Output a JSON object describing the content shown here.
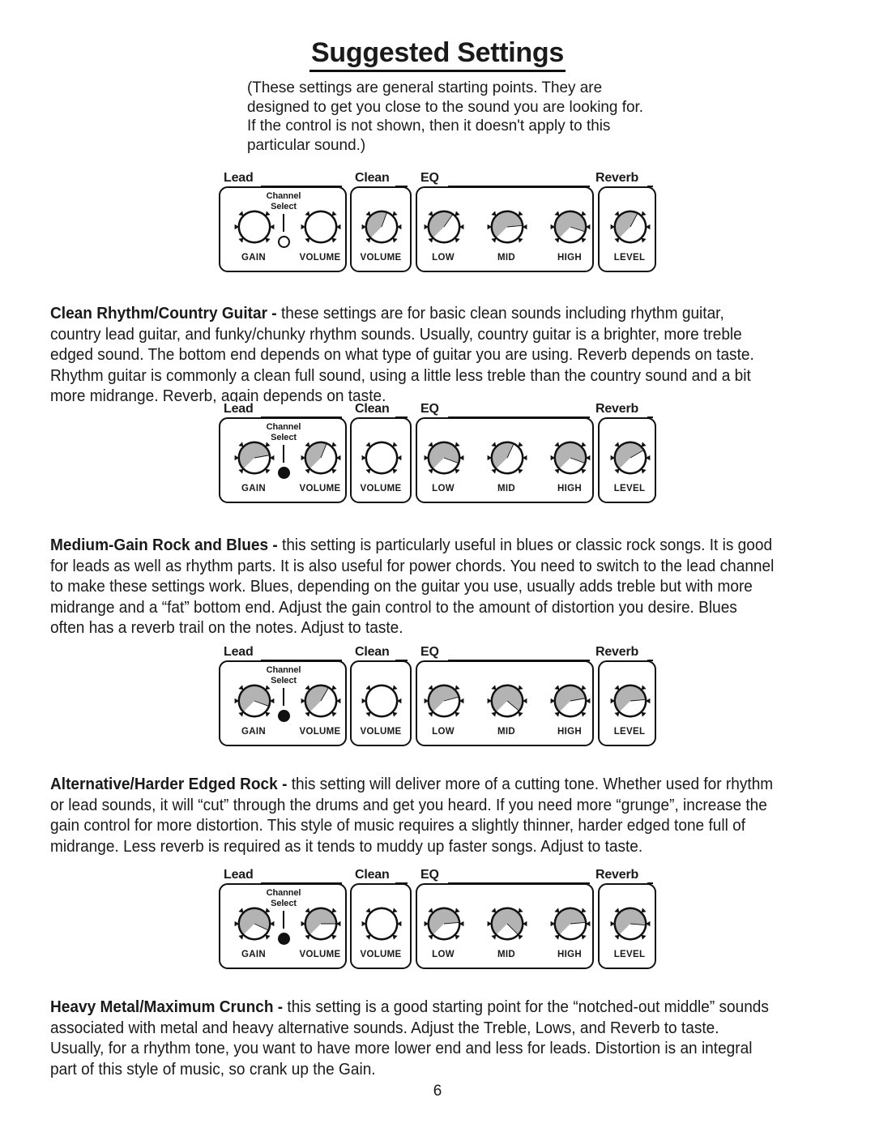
{
  "document": {
    "title": "Suggested Settings",
    "intro": "(These settings are general starting points.  They are designed to get you close to the sound you are looking for.  If the control is not shown, then it doesn't apply to this particular sound.)",
    "page_number": "6"
  },
  "panel_labels": {
    "lead": "Lead",
    "clean": "Clean",
    "eq": "EQ",
    "reverb": "Reverb",
    "channel_select": "Channel Select",
    "channel_select_line1": "Channel",
    "channel_select_line2": "Select",
    "gain": "GAIN",
    "lead_volume": "VOLUME",
    "clean_volume": "VOLUME",
    "low": "LOW",
    "mid": "MID",
    "high": "HIGH",
    "level": "LEVEL"
  },
  "colors": {
    "ink": "#111111",
    "wedge_fill": "#b3b3b3",
    "paper": "#ffffff"
  },
  "sections": [
    {
      "id": "clean-rhythm-country-guitar",
      "heading": "Clean Rhythm/Country Guitar",
      "dash": " - ",
      "body": "these settings are for basic clean sounds including rhythm guitar, country lead guitar, and funky/chunky rhythm sounds.  Usually, country guitar is a brighter, more treble edged sound.  The bottom end depends on what type of guitar you are using.  Reverb depends on taste.  Rhythm guitar is commonly a clean full sound, using a little less treble than the country sound and a bit more midrange. Reverb, again depends on taste."
    },
    {
      "id": "medium-gain-rock-and-blues",
      "heading": "Medium-Gain Rock and Blues",
      "dash": " - ",
      "body": "this setting is particularly useful in blues or classic rock songs.  It is good for leads as well as rhythm parts.  It is also useful for power chords.  You need to switch to the lead channel to make these settings work.  Blues, depending on the guitar you use, usually adds treble but with more midrange and a “fat” bottom end.  Adjust the gain control to the amount of distortion you desire.  Blues often has a reverb trail on the notes.  Adjust to taste."
    },
    {
      "id": "alternative-harder-edged-rock",
      "heading": "Alternative/Harder Edged Rock",
      "dash": " - ",
      "body": "this setting will deliver more of a cutting tone.  Whether used for rhythm or lead sounds, it will “cut” through the drums and get you heard.  If you need more “grunge”, increase the gain control for more distortion.  This style of music requires a slightly thinner, harder edged tone full of midrange.  Less reverb is required as it tends to muddy up faster songs.  Adjust to taste."
    },
    {
      "id": "heavy-metal-maximum-crunch",
      "heading": "Heavy Metal/Maximum Crunch",
      "dash": " - ",
      "body": "this setting is a good starting point for the “notched-out middle” sounds associated with metal and heavy alternative sounds.  Adjust the Treble, Lows, and Reverb to taste.  Usually, for a rhythm tone, you want to have more lower end and less for leads.  Distortion is an integral part of this style of music, so crank up the Gain."
    }
  ],
  "settings_diagrams": [
    {
      "id": "diagram-clean-rhythm",
      "for_section": "clean-rhythm-country-guitar",
      "channel_select_led": "off",
      "channel": "clean",
      "knobs": {
        "gain": {
          "label": "GAIN",
          "angle_deg": 225,
          "wedge": false
        },
        "lead_volume": {
          "label": "VOLUME",
          "angle_deg": 225,
          "wedge": false
        },
        "clean_volume": {
          "label": "VOLUME",
          "angle_deg": 20,
          "wedge": true
        },
        "low": {
          "label": "LOW",
          "angle_deg": 35,
          "wedge": true
        },
        "mid": {
          "label": "MID",
          "angle_deg": 85,
          "wedge": true
        },
        "high": {
          "label": "HIGH",
          "angle_deg": 108,
          "wedge": true
        },
        "level": {
          "label": "LEVEL",
          "angle_deg": 28,
          "wedge": true
        }
      }
    },
    {
      "id": "diagram-medium-gain",
      "for_section": "medium-gain-rock-and-blues",
      "channel_select_led": "on",
      "channel": "lead",
      "knobs": {
        "gain": {
          "label": "GAIN",
          "angle_deg": 80,
          "wedge": true
        },
        "lead_volume": {
          "label": "VOLUME",
          "angle_deg": 22,
          "wedge": true
        },
        "clean_volume": {
          "label": "VOLUME",
          "angle_deg": 225,
          "wedge": false
        },
        "low": {
          "label": "LOW",
          "angle_deg": 110,
          "wedge": true
        },
        "mid": {
          "label": "MID",
          "angle_deg": 25,
          "wedge": true
        },
        "high": {
          "label": "HIGH",
          "angle_deg": 110,
          "wedge": true
        },
        "level": {
          "label": "LEVEL",
          "angle_deg": 60,
          "wedge": true
        }
      }
    },
    {
      "id": "diagram-alternative-rock",
      "for_section": "alternative-harder-edged-rock",
      "channel_select_led": "on",
      "channel": "lead",
      "knobs": {
        "gain": {
          "label": "GAIN",
          "angle_deg": 110,
          "wedge": true
        },
        "lead_volume": {
          "label": "VOLUME",
          "angle_deg": 30,
          "wedge": true
        },
        "clean_volume": {
          "label": "VOLUME",
          "angle_deg": 225,
          "wedge": false
        },
        "low": {
          "label": "LOW",
          "angle_deg": 75,
          "wedge": true
        },
        "mid": {
          "label": "MID",
          "angle_deg": 130,
          "wedge": true
        },
        "high": {
          "label": "HIGH",
          "angle_deg": 80,
          "wedge": true
        },
        "level": {
          "label": "LEVEL",
          "angle_deg": 85,
          "wedge": true
        }
      }
    },
    {
      "id": "diagram-heavy-metal",
      "for_section": "heavy-metal-maximum-crunch",
      "channel_select_led": "on",
      "channel": "lead",
      "knobs": {
        "gain": {
          "label": "GAIN",
          "angle_deg": 115,
          "wedge": true
        },
        "lead_volume": {
          "label": "VOLUME",
          "angle_deg": 90,
          "wedge": true
        },
        "clean_volume": {
          "label": "VOLUME",
          "angle_deg": 225,
          "wedge": false
        },
        "low": {
          "label": "LOW",
          "angle_deg": 85,
          "wedge": true
        },
        "mid": {
          "label": "MID",
          "angle_deg": 135,
          "wedge": true
        },
        "high": {
          "label": "HIGH",
          "angle_deg": 85,
          "wedge": true
        },
        "level": {
          "label": "LEVEL",
          "angle_deg": 95,
          "wedge": true
        }
      }
    }
  ],
  "layout": {
    "diagram_tops": [
      212,
      497,
      797,
      1072
    ],
    "paragraph_tops": [
      374,
      660,
      955,
      1230
    ]
  }
}
